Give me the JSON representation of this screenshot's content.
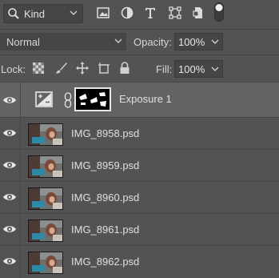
{
  "filter": {
    "kind_label": "Kind",
    "icons": [
      "search-icon",
      "image-filter-icon",
      "adjustment-filter-icon",
      "type-filter-icon",
      "shape-filter-icon",
      "smart-object-filter-icon",
      "filter-toggle-icon"
    ]
  },
  "blend": {
    "mode": "Normal",
    "opacity_label": "Opacity:",
    "opacity_value": "100%"
  },
  "lock": {
    "label": "Lock:",
    "icons": [
      "lock-transparent-icon",
      "lock-image-icon",
      "lock-position-icon",
      "lock-artboard-icon",
      "lock-all-icon"
    ],
    "fill_label": "Fill:",
    "fill_value": "100%"
  },
  "layers": [
    {
      "name": "Exposure 1",
      "type": "adjustment",
      "selected": true
    },
    {
      "name": "IMG_8958.psd",
      "type": "smart-object"
    },
    {
      "name": "IMG_8959.psd",
      "type": "smart-object"
    },
    {
      "name": "IMG_8960.psd",
      "type": "smart-object"
    },
    {
      "name": "IMG_8961.psd",
      "type": "smart-object"
    },
    {
      "name": "IMG_8962.psd",
      "type": "smart-object"
    }
  ],
  "colors": {
    "panel_bg": "#535353",
    "selected_bg": "#636363",
    "field_bg": "#454545",
    "text": "#d6d6d6"
  }
}
